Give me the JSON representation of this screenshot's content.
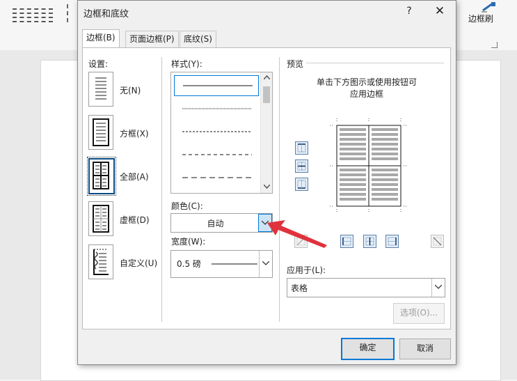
{
  "app": {
    "ribbon_button_label": "边框刷"
  },
  "dialog": {
    "title": "边框和底纹",
    "help": "?",
    "close": "✕",
    "tabs": [
      "边框(B)",
      "页面边框(P)",
      "底纹(S)"
    ],
    "settings": {
      "label": "设置:",
      "items": [
        "无(N)",
        "方框(X)",
        "全部(A)",
        "虚框(D)",
        "自定义(U)"
      ],
      "selected": 2
    },
    "style": {
      "label": "样式(Y):",
      "options": [
        "solid",
        "dotted-fine",
        "dashed-small",
        "dashed",
        "dash-long"
      ],
      "selected": 0
    },
    "color": {
      "label": "颜色(C):",
      "value": "自动"
    },
    "width": {
      "label": "宽度(W):",
      "value": "0.5 磅"
    },
    "preview": {
      "label": "预览",
      "hint_line1": "单击下方图示或使用按钮可",
      "hint_line2": "应用边框"
    },
    "apply_to": {
      "label": "应用于(L):",
      "value": "表格"
    },
    "options_button": "选项(O)...",
    "ok_button": "确定",
    "cancel_button": "取消"
  },
  "colors": {
    "accent": "#0078d7",
    "arrow": "#e0323c",
    "selected_border": "#0a4c85"
  }
}
